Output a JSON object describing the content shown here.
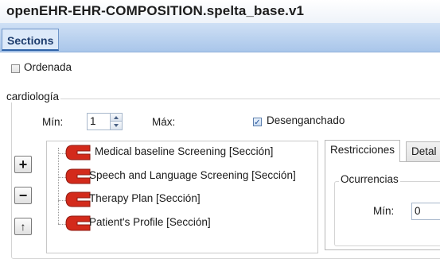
{
  "window": {
    "title": "openEHR-EHR-COMPOSITION.spelta_base.v1"
  },
  "tabs": {
    "sections": "Sections"
  },
  "ordered_checkbox": {
    "label": "Ordenada",
    "checked": false
  },
  "group": {
    "legend": "cardiología",
    "min_label": "Mín:",
    "min_value": "1",
    "max_label": "Máx:",
    "unbounded_label": "Desenganchado",
    "unbounded_checked": true
  },
  "side_buttons": {
    "add": "+",
    "remove": "−",
    "move_up": "↑"
  },
  "tree": {
    "items": [
      {
        "label": "Medical baseline Screening [Sección]",
        "icon": "section-icon"
      },
      {
        "label": "Speech and Language Screening [Sección]",
        "icon": "section-icon"
      },
      {
        "label": "Therapy Plan [Sección]",
        "icon": "section-icon"
      },
      {
        "label": "Patient's Profile [Sección]",
        "icon": "section-icon"
      }
    ]
  },
  "details": {
    "tabs": [
      "Restricciones",
      "Detal"
    ],
    "occurrences_legend": "Ocurrencias",
    "min_label": "Mín:",
    "min_value": "0"
  },
  "colors": {
    "tab_strip": "#a9c6ea",
    "section_icon": "#d32a1b",
    "accent": "#2f63a8"
  }
}
